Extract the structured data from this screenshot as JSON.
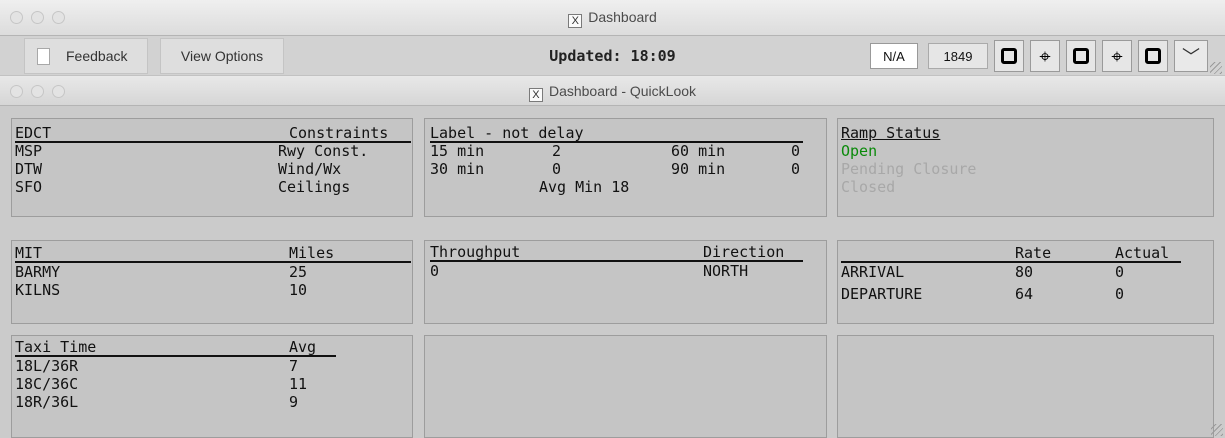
{
  "window": {
    "title": "Dashboard",
    "inner_title": "Dashboard - QuickLook"
  },
  "toolbar": {
    "feedback_label": "Feedback",
    "view_options_label": "View Options",
    "updated_label": "Updated: 18:09",
    "na_label": "N/A",
    "count_label": "1849"
  },
  "edct": {
    "header_left": "EDCT",
    "header_right": "Constraints",
    "rows": [
      {
        "airport": "MSP",
        "constraint": "Rwy Const."
      },
      {
        "airport": "DTW",
        "constraint": "Wind/Wx"
      },
      {
        "airport": "SFO",
        "constraint": "Ceilings"
      }
    ]
  },
  "label_delay": {
    "header": "Label - not delay",
    "rows": [
      {
        "bucket_a": "15 min",
        "value_a": "2",
        "bucket_b": "60 min",
        "value_b": "0"
      },
      {
        "bucket_a": "30 min",
        "value_a": "0",
        "bucket_b": "90 min",
        "value_b": "0"
      }
    ],
    "avg": "Avg Min 18"
  },
  "ramp": {
    "header": "Ramp Status",
    "open": "Open",
    "pending": "Pending Closure",
    "closed": "Closed",
    "colors": {
      "open": "#0a8a0a",
      "inactive": "#a8a8a8"
    }
  },
  "mit": {
    "header_left": "MIT",
    "header_right": "Miles",
    "rows": [
      {
        "fix": "BARMY",
        "miles": "25"
      },
      {
        "fix": "KILNS",
        "miles": "10"
      }
    ]
  },
  "throughput": {
    "header_left": "Throughput",
    "header_right": "Direction",
    "value": "0",
    "direction": "NORTH"
  },
  "rates": {
    "header_rate": "Rate",
    "header_actual": "Actual",
    "rows": [
      {
        "kind": "ARRIVAL",
        "rate": "80",
        "actual": "0"
      },
      {
        "kind": "DEPARTURE",
        "rate": "64",
        "actual": "0"
      }
    ]
  },
  "taxi": {
    "header_left": "Taxi Time",
    "header_right": "Avg",
    "rows": [
      {
        "runway": "18L/36R",
        "avg": "7"
      },
      {
        "runway": "18C/36C",
        "avg": "11"
      },
      {
        "runway": "18R/36L",
        "avg": "9"
      }
    ]
  }
}
